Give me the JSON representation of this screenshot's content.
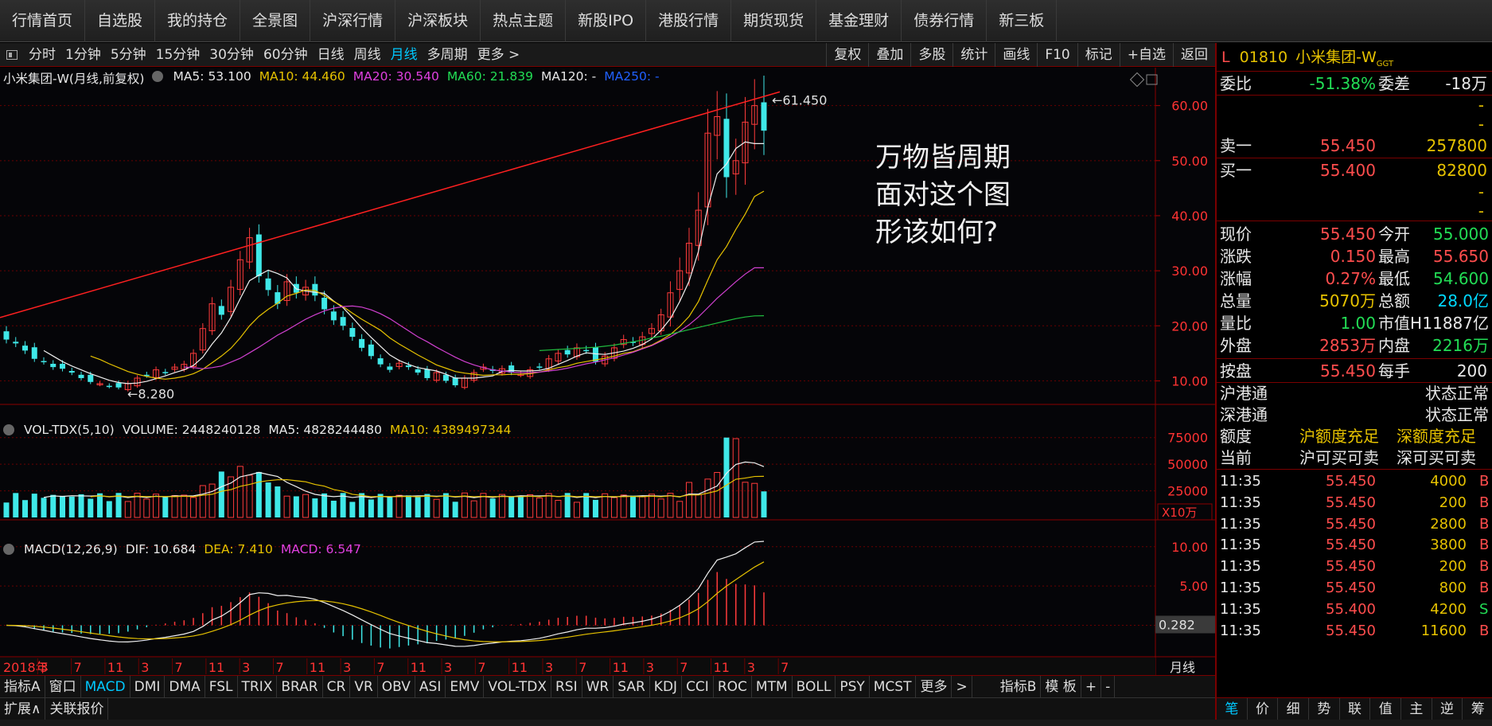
{
  "top_nav": [
    "行情首页",
    "自选股",
    "我的持仓",
    "全景图",
    "沪深行情",
    "沪深板块",
    "热点主题",
    "新股IPO",
    "港股行情",
    "期货现货",
    "基金理财",
    "债券行情",
    "新三板"
  ],
  "period_bar": {
    "items": [
      "分时",
      "1分钟",
      "5分钟",
      "15分钟",
      "30分钟",
      "60分钟",
      "日线",
      "周线",
      "月线",
      "多周期",
      "更多 >"
    ],
    "active": "月线",
    "right_items": [
      "复权",
      "叠加",
      "多股",
      "统计",
      "画线",
      "F10",
      "标记",
      "+自选",
      "返回"
    ]
  },
  "main_legend": {
    "title": "小米集团-W(月线,前复权)",
    "ma5": "MA5: 53.100",
    "ma10": "MA10: 44.460",
    "ma20": "MA20: 30.540",
    "ma60": "MA60: 21.839",
    "ma120": "MA120: -",
    "ma250": "MA250: -"
  },
  "vol_legend": {
    "title": "VOL-TDX(5,10)",
    "volume": "VOLUME: 2448240128",
    "ma5": "MA5: 4828244480",
    "ma10": "MA10: 4389497344"
  },
  "macd_legend": {
    "title": "MACD(12,26,9)",
    "dif": "DIF: 10.684",
    "dea": "DEA: 7.410",
    "macd": "MACD: 6.547"
  },
  "overlay_text": [
    "万物皆周期",
    "面对这个图",
    "形该如何?"
  ],
  "annotations": {
    "high": "61.450",
    "low": "8.280",
    "macd_readout": "0.282",
    "vol_unit": "X10万",
    "period_label": "月线"
  },
  "chart_data": [
    {
      "type": "candlestick",
      "title": "小米集团-W(月线,前复权)",
      "y_ticks": [
        "60.00",
        "50.00",
        "40.00",
        "30.00",
        "20.00",
        "10.00"
      ],
      "ylim": [
        5,
        64
      ],
      "x_labels": [
        "2018年",
        "3",
        "7",
        "11",
        "3",
        "7",
        "11",
        "3",
        "7",
        "11",
        "3",
        "7",
        "11",
        "3",
        "7",
        "11",
        "3",
        "7",
        "11",
        "3",
        "7",
        "11",
        "3",
        "7"
      ],
      "close": [
        17.5,
        16.8,
        15.5,
        14,
        13.5,
        12.5,
        12.2,
        11.5,
        10.5,
        9.8,
        9.5,
        9,
        8.8,
        9.5,
        10.5,
        11,
        12,
        11.5,
        12.5,
        13,
        15,
        19.5,
        24,
        22,
        27,
        32,
        36,
        29,
        26.5,
        24,
        28,
        26,
        27,
        25.5,
        23,
        21,
        20,
        18,
        16,
        14.5,
        13,
        12,
        13.2,
        12.5,
        11.5,
        10.5,
        11.5,
        10,
        9.2,
        10.5,
        11.5,
        12.5,
        11.8,
        12.2,
        11.5,
        11.2,
        12,
        12.5,
        14,
        15,
        14.8,
        16,
        15.5,
        13.5,
        14.5,
        16,
        17.5,
        17,
        18,
        19.5,
        22,
        26,
        30,
        35,
        41,
        55,
        58,
        47,
        50,
        57,
        60,
        55.45
      ],
      "ma5": [
        null,
        null,
        null,
        null,
        15.5,
        14.5,
        13.5,
        12.7,
        12,
        11.3,
        10.7,
        10.1,
        9.7,
        9.5,
        9.6,
        9.9,
        10.4,
        10.9,
        11.5,
        12,
        12.8,
        14.3,
        16.7,
        18.7,
        21.5,
        24.9,
        28.2,
        29.2,
        30.1,
        29.5,
        28.7,
        26.7,
        26.3,
        26.1,
        25.9,
        24.5,
        23.3,
        21.5,
        19.6,
        17.9,
        16.3,
        14.7,
        13.7,
        13.0,
        12.4,
        12.1,
        11.8,
        11.2,
        10.5,
        10.5,
        10.5,
        10.7,
        10.9,
        11.7,
        11.9,
        11.8,
        11.8,
        11.9,
        12.3,
        13,
        13.7,
        14.5,
        15.1,
        14.9,
        14.8,
        15.1,
        15.4,
        15.9,
        16.6,
        17.6,
        19.2,
        21.3,
        24.4,
        28.1,
        33.5,
        41.5,
        47.6,
        49.4,
        52.2,
        53.4,
        53.1,
        53.1
      ],
      "ma10": [
        null,
        null,
        null,
        null,
        null,
        null,
        null,
        null,
        null,
        14.5,
        13.9,
        13.1,
        12.4,
        11.7,
        11.2,
        10.8,
        10.5,
        10.3,
        10.5,
        10.8,
        11.3,
        12.1,
        13.3,
        14.5,
        15.9,
        17.8,
        20,
        21.7,
        23,
        24.1,
        25.4,
        25.9,
        26.5,
        26.4,
        25.5,
        24.4,
        23.5,
        22.3,
        21.2,
        20.2,
        19.2,
        17.8,
        16.7,
        15.7,
        14.7,
        13.8,
        12.9,
        12.3,
        11.7,
        11.4,
        11.2,
        11,
        11.1,
        11.1,
        11.2,
        11.2,
        11.3,
        11.6,
        12,
        12.4,
        12.7,
        13.2,
        13.5,
        13.8,
        14.1,
        14.5,
        15,
        15.3,
        15.9,
        16.5,
        17.4,
        18.4,
        19.9,
        21.7,
        24.4,
        28.3,
        32,
        34.4,
        37.5,
        40.3,
        43.5,
        44.46
      ],
      "ma20": [
        null,
        null,
        null,
        null,
        null,
        null,
        null,
        null,
        null,
        null,
        null,
        null,
        null,
        null,
        null,
        null,
        null,
        null,
        null,
        12.5,
        12.4,
        12.2,
        12.4,
        12.7,
        13.4,
        14.1,
        15.1,
        16.1,
        17.2,
        18.3,
        19.2,
        20.2,
        21.2,
        22,
        22.7,
        23.2,
        23.5,
        23.6,
        23.4,
        22.9,
        22.2,
        21.3,
        20.2,
        19.1,
        18,
        17.1,
        16.1,
        15.2,
        14.3,
        13.5,
        12.9,
        12.4,
        12,
        11.8,
        11.6,
        11.5,
        11.5,
        11.6,
        11.8,
        12,
        12.3,
        12.7,
        13.1,
        13.4,
        13.8,
        14.2,
        14.7,
        15.2,
        15.8,
        16.4,
        17.2,
        18,
        19,
        20.2,
        21.6,
        23.3,
        25,
        26.5,
        28,
        29.4,
        30.54,
        30.54
      ],
      "ma60": [
        null,
        null,
        null,
        null,
        null,
        null,
        null,
        null,
        null,
        null,
        null,
        null,
        null,
        null,
        null,
        null,
        null,
        null,
        null,
        null,
        null,
        null,
        null,
        null,
        null,
        null,
        null,
        null,
        null,
        null,
        null,
        null,
        null,
        null,
        null,
        null,
        null,
        null,
        null,
        null,
        null,
        null,
        null,
        null,
        null,
        null,
        null,
        null,
        null,
        null,
        null,
        null,
        null,
        null,
        null,
        null,
        null,
        15.5,
        15.6,
        15.7,
        15.8,
        15.9,
        16,
        16.1,
        16.3,
        16.5,
        16.8,
        17.1,
        17.4,
        17.8,
        18.1,
        18.5,
        18.9,
        19.3,
        19.7,
        20.1,
        20.5,
        20.9,
        21.3,
        21.6,
        21.8,
        21.839
      ]
    },
    {
      "type": "bar",
      "title": "VOL-TDX(5,10)",
      "y_ticks": [
        "75000",
        "50000",
        "25000"
      ],
      "unit": "X10万",
      "ylim": [
        0,
        80000
      ]
    },
    {
      "type": "bar",
      "title": "MACD(12,26,9)",
      "y_ticks": [
        "10.00",
        "5.00"
      ],
      "ylim": [
        -4,
        12
      ]
    }
  ],
  "indicator_bar": [
    "指标A",
    "窗口",
    "MACD",
    "DMI",
    "DMA",
    "FSL",
    "TRIX",
    "BRAR",
    "CR",
    "VR",
    "OBV",
    "ASI",
    "EMV",
    "VOL-TDX",
    "RSI",
    "WR",
    "SAR",
    "KDJ",
    "CCI",
    "ROC",
    "MTM",
    "BOLL",
    "PSY",
    "MCST",
    "更多",
    ">",
    "指标B",
    "模 板",
    "+",
    "-"
  ],
  "indicator_active": "MACD",
  "bottom_bar": [
    "扩展∧",
    "关联报价"
  ],
  "quote_panel": {
    "code": "01810",
    "name": "小米集团-W",
    "tag": "GGT",
    "prefix": "L",
    "weibi_label": "委比",
    "weibi": "-51.38%",
    "weicha_label": "委差",
    "weicha": "-18万",
    "ask1_label": "卖一",
    "ask1_price": "55.450",
    "ask1_vol": "257800",
    "bid1_label": "买一",
    "bid1_price": "55.400",
    "bid1_vol": "82800",
    "dash": "-",
    "stats": [
      {
        "l1": "现价",
        "v1": "55.450",
        "l2": "今开",
        "v2": "55.000"
      },
      {
        "l1": "涨跌",
        "v1": "0.150",
        "l2": "最高",
        "v2": "55.650"
      },
      {
        "l1": "涨幅",
        "v1": "0.27%",
        "l2": "最低",
        "v2": "54.600"
      },
      {
        "l1": "总量",
        "v1": "5070万",
        "l2": "总额",
        "v2": "28.0亿"
      },
      {
        "l1": "量比",
        "v1": "1.00",
        "l2": "市值H",
        "v2": "11887亿"
      },
      {
        "l1": "外盘",
        "v1": "2853万",
        "l2": "内盘",
        "v2": "2216万"
      }
    ],
    "anpan_label": "按盘",
    "anpan": "55.450",
    "meishou_label": "每手",
    "meishou": "200",
    "connect": [
      {
        "l": "沪港通",
        "v": "状态正常"
      },
      {
        "l": "深港通",
        "v": "状态正常"
      }
    ],
    "quota_label": "额度",
    "quota_sh": "沪额度充足",
    "quota_sz": "深额度充足",
    "now_label": "当前",
    "now_sh": "沪可买可卖",
    "now_sz": "深可买可卖",
    "ticks": [
      {
        "t": "11:35",
        "p": "55.450",
        "v": "4000",
        "s": "B"
      },
      {
        "t": "11:35",
        "p": "55.450",
        "v": "200",
        "s": "B"
      },
      {
        "t": "11:35",
        "p": "55.450",
        "v": "2800",
        "s": "B"
      },
      {
        "t": "11:35",
        "p": "55.450",
        "v": "3800",
        "s": "B"
      },
      {
        "t": "11:35",
        "p": "55.450",
        "v": "200",
        "s": "B"
      },
      {
        "t": "11:35",
        "p": "55.450",
        "v": "800",
        "s": "B"
      },
      {
        "t": "11:35",
        "p": "55.400",
        "v": "4200",
        "s": "S"
      },
      {
        "t": "11:35",
        "p": "55.450",
        "v": "11600",
        "s": "B"
      }
    ],
    "tabs": [
      "笔",
      "价",
      "细",
      "势",
      "联",
      "值",
      "主",
      "逆",
      "筹"
    ]
  }
}
